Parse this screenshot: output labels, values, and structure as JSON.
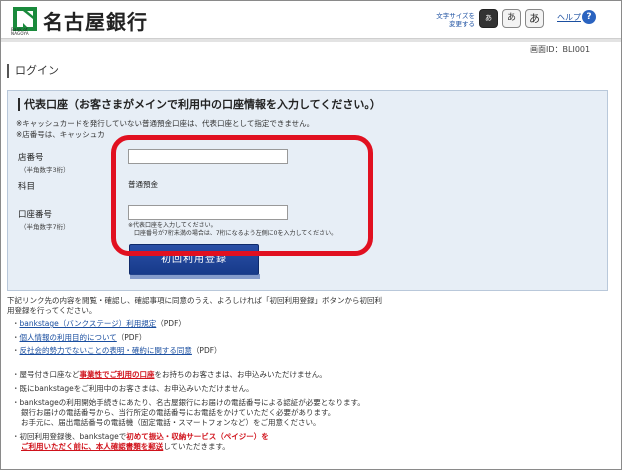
{
  "header": {
    "logo_text": "名古屋銀行",
    "logo_sub": "Bank of NAGOYA",
    "font_size_label_line1": "文字サイズを",
    "font_size_label_line2": "変更する",
    "font_buttons": [
      "あ",
      "あ",
      "あ"
    ],
    "help_label": "ヘルプ",
    "help_icon_glyph": "?"
  },
  "screen_id": "画面ID：BLI001",
  "section_title": "ログイン",
  "panel": {
    "heading": "代表口座（お客さまがメインで利用中の口座情報を入力してください。）",
    "note1": "※キャッシュカードを発行していない普通預金口座は、代表口座として指定できません。",
    "note2": "※店番号は、キャッシュカ",
    "branch_label": "店番号",
    "branch_sub": "（半角数字3桁）",
    "branch_value": "",
    "subject_label": "科目",
    "subject_value": "普通預金",
    "account_label": "口座番号",
    "account_sub": "（半角数字7桁）",
    "account_value": "",
    "hint1": "※代表口座を入力してください。",
    "hint2": "口座番号が7桁未満の場合は、7桁になるよう左側に0を入力してください。",
    "register_button": "初回利用登録"
  },
  "instructions": {
    "line1": "下記リンク先の内容を閲覧・確認し、確認事項に同意のうえ、よろしければ「初回利用登録」ボタンから初回利",
    "line2": "用登録を行ってください。",
    "links": [
      {
        "text": "bankstage（バンクステージ）利用規定",
        "suffix": "（PDF）"
      },
      {
        "text": "個人情報の利用目的について",
        "suffix": "（PDF）"
      },
      {
        "text": "反社会的勢力でないことの表明・確約に関する同意",
        "suffix": "（PDF）"
      }
    ]
  },
  "notices": {
    "n1_pre": "屋号付き口座など",
    "n1_red": "事業性でご利用の口座",
    "n1_post": "をお持ちのお客さまは、お申込みいただけません。",
    "n2": "既にbankstageをご利用中のお客さまは、お申込みいただけません。",
    "n3_line1": "bankstageの利用開始手続きにあたり、名古屋銀行にお届けの電話番号による認証が必要となります。",
    "n3_line2": "銀行お届けの電話番号から、当行所定の電話番号にお電話をかけていただく必要があります。",
    "n3_line3": "お手元に、届出電話番号の電話機（固定電話・スマートフォンなど）をご用意ください。",
    "n4_pre": "初回利用登録後、bankstageで",
    "n4_red": "初めて振込・収納サービス（ペイジー）を",
    "n4_line2_red": "ご利用いただく前に、本人確認書類を郵送",
    "n4_line2_post": "していただきます。"
  },
  "colors": {
    "accent_blue": "#1b4fa0",
    "button_blue": "#173a8a",
    "highlight_red": "#e11020",
    "panel_bg": "#e7eef6",
    "logo_green": "#1a8a3c"
  }
}
